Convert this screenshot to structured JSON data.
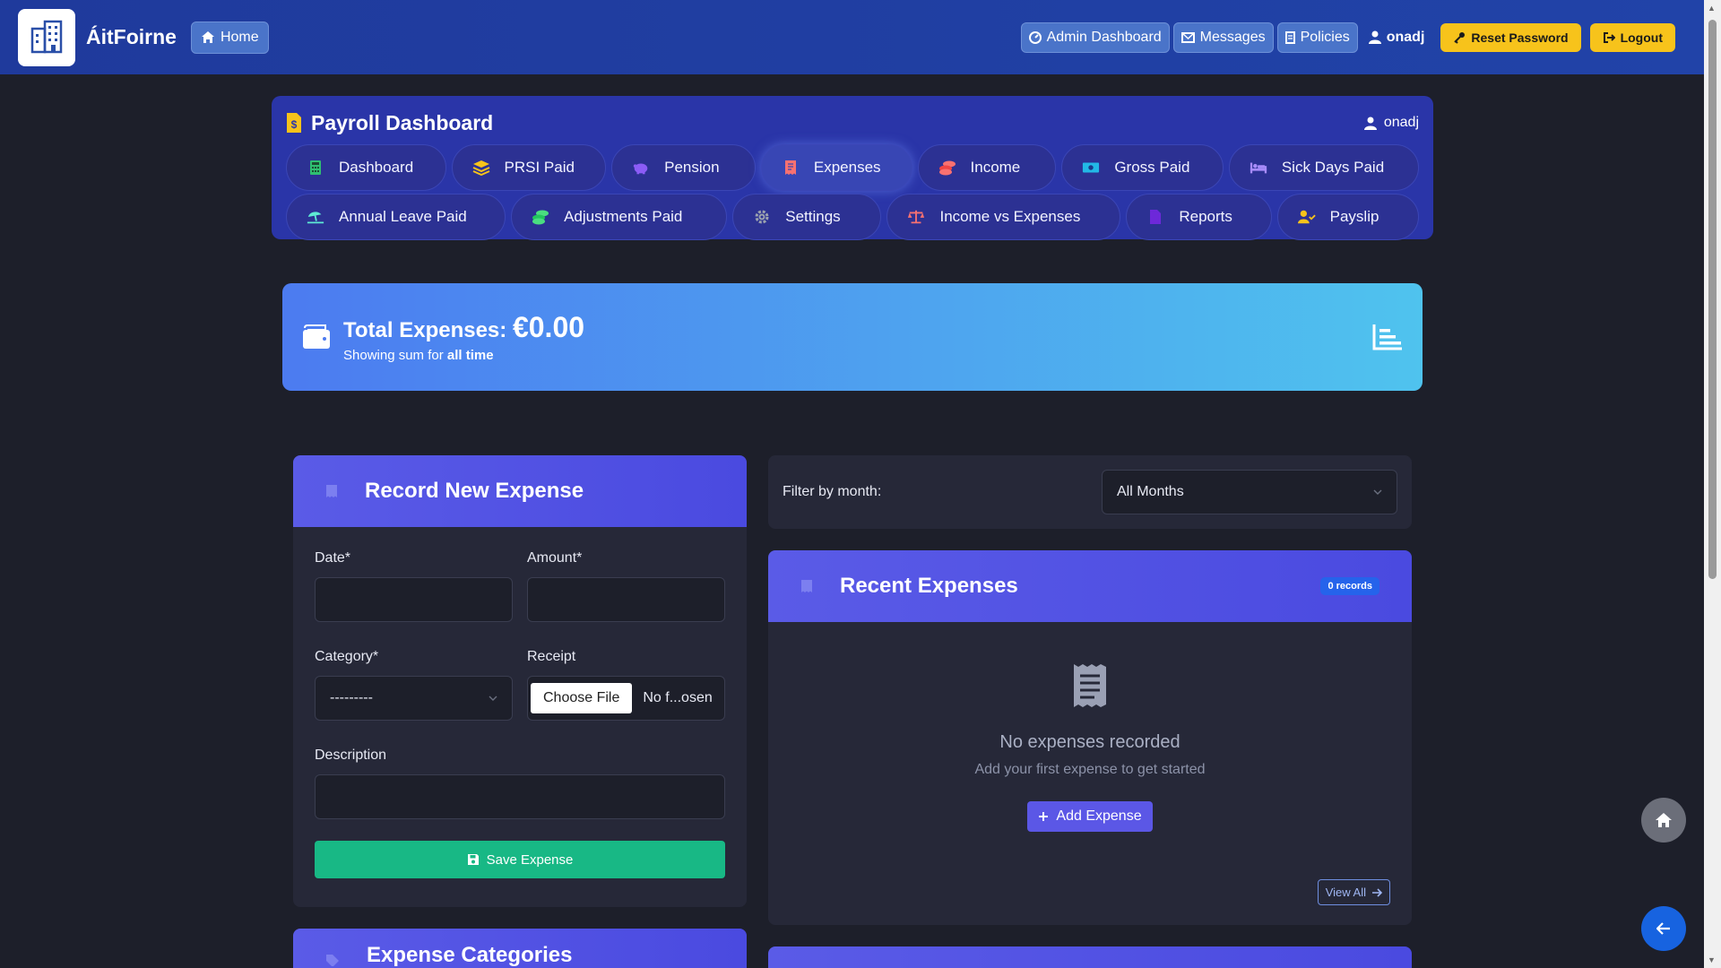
{
  "nav": {
    "brand": "ÁitFoirne",
    "home": "Home",
    "admin_dashboard": "Admin Dashboard",
    "messages": "Messages",
    "policies": "Policies",
    "user": "onadj",
    "reset_password": "Reset Password",
    "logout": "Logout"
  },
  "dashboard": {
    "title": "Payroll Dashboard",
    "user": "onadj",
    "tabs_row1": [
      "Dashboard",
      "PRSI Paid",
      "Pension",
      "Expenses",
      "Income",
      "Gross Paid",
      "Sick Days Paid"
    ],
    "tabs_row2": [
      "Annual Leave Paid",
      "Adjustments Paid",
      "Settings",
      "Income vs Expenses",
      "Reports",
      "Payslip"
    ],
    "active_tab": "Expenses"
  },
  "total": {
    "label": "Total Expenses:",
    "amount": "€0.00",
    "sub_prefix": "Showing sum for",
    "sub_bold": "all time"
  },
  "form": {
    "title": "Record New Expense",
    "date_label": "Date*",
    "amount_label": "Amount*",
    "category_label": "Category*",
    "category_value": "---------",
    "receipt_label": "Receipt",
    "choose_file": "Choose File",
    "no_file": "No f...osen",
    "description_label": "Description",
    "save": "Save Expense"
  },
  "filter": {
    "label": "Filter by month:",
    "value": "All Months"
  },
  "recent": {
    "title": "Recent Expenses",
    "badge": "0 records",
    "empty_title": "No expenses recorded",
    "empty_sub": "Add your first expense to get started",
    "add": "Add Expense",
    "view_all": "View All"
  },
  "categories": {
    "title": "Expense Categories"
  },
  "colors": {
    "navbar": "#2143a8",
    "panel": "#2a35a8",
    "accent": "#5a5be7",
    "save": "#18b885",
    "warning": "#f7c31b"
  }
}
